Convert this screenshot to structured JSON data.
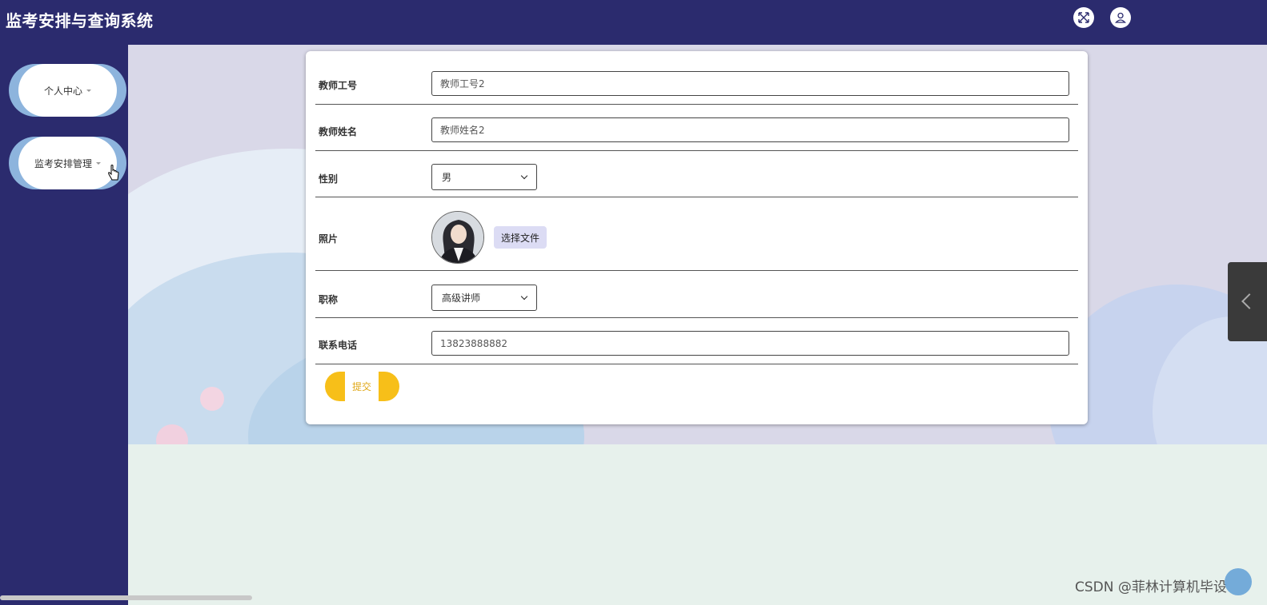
{
  "app": {
    "title": "监考安排与查询系统"
  },
  "header": {
    "icons": [
      "fullscreen-icon",
      "user-icon"
    ]
  },
  "sidebar": {
    "items": [
      {
        "label": "个人中心"
      },
      {
        "label": "监考安排管理"
      }
    ]
  },
  "form": {
    "teacher_id": {
      "label": "教师工号",
      "value": "教师工号2"
    },
    "teacher_name": {
      "label": "教师姓名",
      "value": "教师姓名2"
    },
    "gender": {
      "label": "性别",
      "value": "男"
    },
    "photo": {
      "label": "照片",
      "button_label": "选择文件"
    },
    "title": {
      "label": "职称",
      "value": "高级讲师"
    },
    "phone": {
      "label": "联系电话",
      "value": "13823888882"
    },
    "submit_label": "提交"
  },
  "watermark": "CSDN @菲林计算机毕设",
  "colors": {
    "topbar": "#2b2b6e",
    "sidebar": "#2b2b6e",
    "menu_pill_edge": "#8db4dd",
    "submit_accent": "#f7bf19",
    "file_button": "#dcdcf4"
  }
}
